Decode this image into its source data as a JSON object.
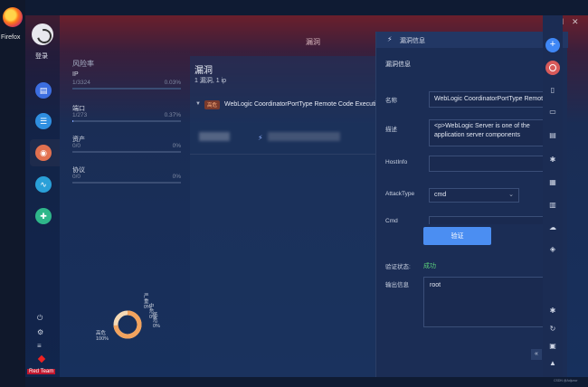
{
  "desktop": {
    "firefox_label": "Firefox"
  },
  "window": {
    "title": "漏洞"
  },
  "nav": {
    "login": "登录",
    "badge": "Red Team"
  },
  "risk": {
    "title": "风险率",
    "rows": [
      {
        "name": "IP",
        "count": "1/3324",
        "pct": "0.03%",
        "fill": 0.0003
      },
      {
        "name": "端口",
        "count": "1/273",
        "pct": "0.37%",
        "fill": 0.0037
      },
      {
        "name": "资产",
        "count": "0/0",
        "pct": "0%",
        "fill": 0
      },
      {
        "name": "协议",
        "count": "0/0",
        "pct": "0%",
        "fill": 0
      }
    ],
    "donut": {
      "labels": [
        {
          "text": "严重",
          "value": "0%"
        },
        {
          "text": "中危",
          "value": "0%"
        },
        {
          "text": "低危",
          "value": "0%"
        },
        {
          "text": "高危",
          "value": "100%"
        }
      ],
      "colors": {
        "high": "#f2a35e",
        "ring": "#f5d9b5"
      }
    }
  },
  "vulnlist": {
    "title": "漏洞",
    "subtitle": "1 漏洞, 1 ip",
    "item": {
      "severity": "高危",
      "name": "WebLogic CoordinatorPortType Remote Code Execution"
    }
  },
  "drawer": {
    "title": "漏洞信息",
    "section": "漏洞信息",
    "fields": {
      "name_label": "名称",
      "name_value": "WebLogic CoordinatorPortType Remote Code Execution",
      "desc_label": "描述",
      "desc_value": "<p>WebLogic Server is one of the application server components",
      "hostinfo_label": "HostInfo",
      "hostinfo_value": "",
      "attacktype_label": "AttackType",
      "attacktype_value": "cmd",
      "cmd_label": "Cmd"
    },
    "verify_button": "验证",
    "status_label": "验证状态:",
    "status_value": "成功",
    "output_label": "输出信息",
    "output_value": "root"
  },
  "watermark": "CSDN @Adjunor",
  "colors": {
    "accent": "#4b8ef2",
    "success": "#5bd17a",
    "severity_high": "#ffb280"
  }
}
